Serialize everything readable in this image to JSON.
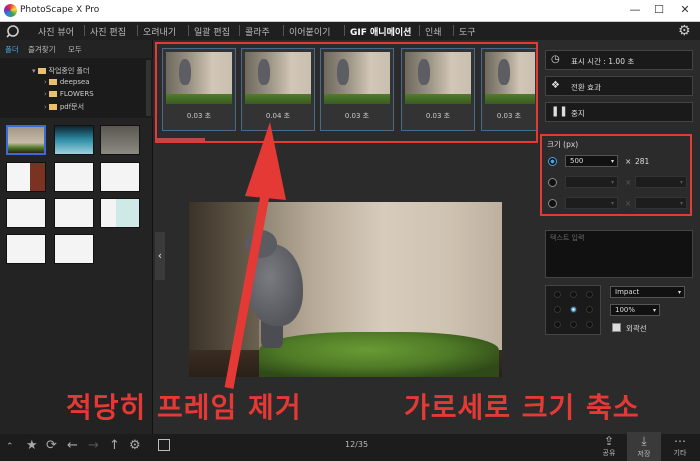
{
  "window": {
    "title": "PhotoScape X Pro",
    "minimize": "—",
    "maximize": "☐",
    "close": "✕"
  },
  "menu": {
    "items": [
      "사진 뷰어",
      "사진 편집",
      "오려내기",
      "일괄 편집",
      "콜라주",
      "이어붙이기",
      "GIF 애니메이션",
      "인쇄",
      "도구"
    ],
    "active_index": 6
  },
  "left_panel": {
    "tabs": [
      "폴더",
      "즐겨찾기",
      "모두"
    ],
    "tree": [
      {
        "label": "작업중인 폴더",
        "open": true
      },
      {
        "label": "deepsea"
      },
      {
        "label": "FLOWERS"
      },
      {
        "label": "pdf문서"
      }
    ]
  },
  "frames": [
    {
      "label": "0.03 초"
    },
    {
      "label": "0.04 초"
    },
    {
      "label": "0.03 초"
    },
    {
      "label": "0.03 초"
    },
    {
      "label": "0.03 초"
    }
  ],
  "right_panel": {
    "display_time": "표시 시간 : 1.00 초",
    "transition": "전환 효과",
    "stop": "중지",
    "size_title": "크기 (px)",
    "size_rows": [
      {
        "w": "500",
        "h": "281",
        "active": true
      },
      {
        "w": "",
        "h": "",
        "active": false
      },
      {
        "w": "",
        "h": "",
        "active": false
      }
    ],
    "x_sign": "×",
    "text_placeholder": "텍스트 입력",
    "font": "Impact",
    "font_size": "100%",
    "outline": "외곽선"
  },
  "bottom": {
    "counter": "12/35",
    "share": "공유",
    "save": "저장",
    "more": "기타"
  },
  "captions": {
    "left": "적당히 프레임 제거",
    "right": "가로세로 크기 축소"
  },
  "colors": {
    "accent": "#4aa3e0",
    "annotation": "#e53935"
  }
}
